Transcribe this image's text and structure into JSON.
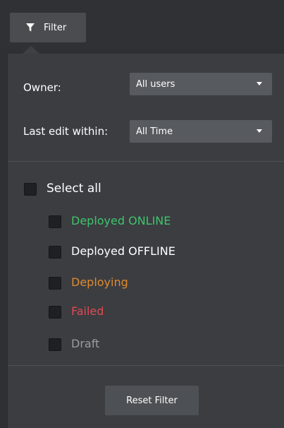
{
  "toolbar": {
    "filter_label": "Filter"
  },
  "filters": {
    "owner_label": "Owner:",
    "owner_value": "All users",
    "last_edit_label": "Last edit within:",
    "last_edit_value": "All Time"
  },
  "status": {
    "select_all_label": "Select all",
    "options": [
      {
        "label": "Deployed ONLINE",
        "color": "#3ec56b"
      },
      {
        "label": "Deployed OFFLINE",
        "color": "#ffffff"
      },
      {
        "label": "Deploying",
        "color": "#e08a2e"
      },
      {
        "label": "Failed",
        "color": "#e04a52"
      },
      {
        "label": "Draft",
        "color": "#9a9c9f"
      }
    ]
  },
  "footer": {
    "reset_label": "Reset Filter"
  }
}
